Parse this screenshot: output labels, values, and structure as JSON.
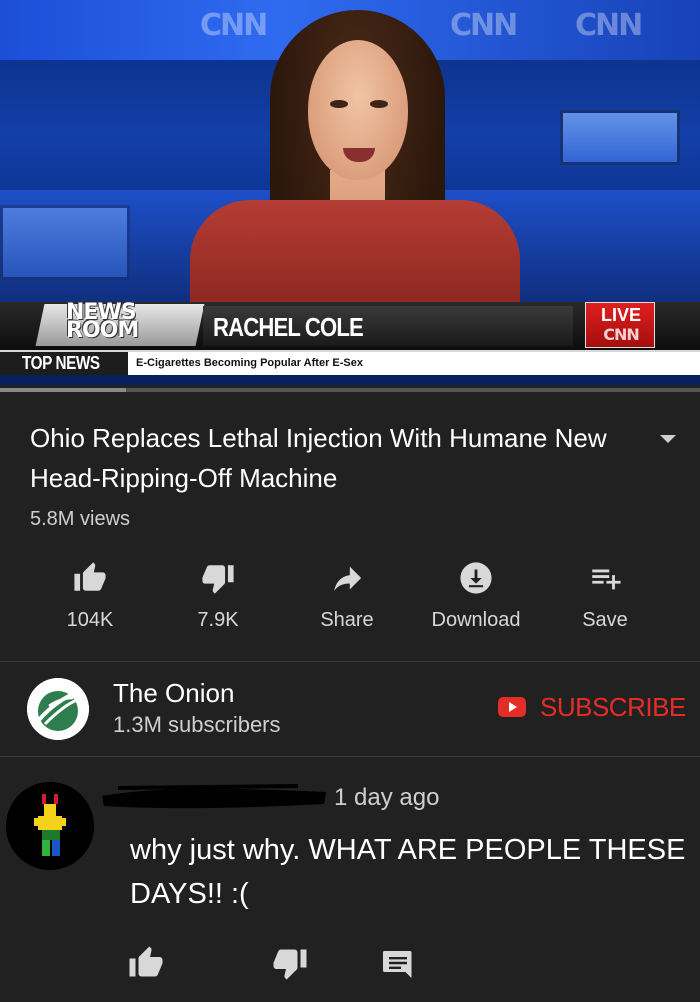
{
  "video": {
    "studio_logos": [
      "CNN",
      "CNN",
      "CNN"
    ],
    "lower_third": {
      "brand": "NEWS ROOM",
      "anchor_name": "RACHEL COLE",
      "live_label": "LIVE",
      "live_network": "CNN"
    },
    "ticker": {
      "label": "TOP NEWS",
      "headline": "E-Cigarettes Becoming Popular After E-Sex"
    },
    "progress": {
      "played_fraction": 0.0,
      "buffered_fraction": 0.18
    },
    "colors": {
      "progress": "#e02020",
      "ticker_bg": "#ffffff"
    }
  },
  "info": {
    "title": "Ohio Replaces Lethal Injection With Humane New Head-Ripping-Off Machine",
    "views": "5.8M views",
    "expand_icon": "chevron-down-icon"
  },
  "actions": [
    {
      "icon": "thumbs-up-icon",
      "label": "104K"
    },
    {
      "icon": "thumbs-down-icon",
      "label": "7.9K"
    },
    {
      "icon": "share-icon",
      "label": "Share"
    },
    {
      "icon": "download-icon",
      "label": "Download"
    },
    {
      "icon": "playlist-add-icon",
      "label": "Save"
    }
  ],
  "channel": {
    "name": "The Onion",
    "subscribers": "1.3M subscribers",
    "subscribe_label": "SUBSCRIBE",
    "subscribe_color": "#e52d27"
  },
  "comment": {
    "time": "1 day ago",
    "text": "why just why. WHAT ARE PEOPLE THESE DAYS!! :(",
    "actions": [
      "thumbs-up-icon",
      "thumbs-down-icon",
      "reply-icon"
    ]
  }
}
